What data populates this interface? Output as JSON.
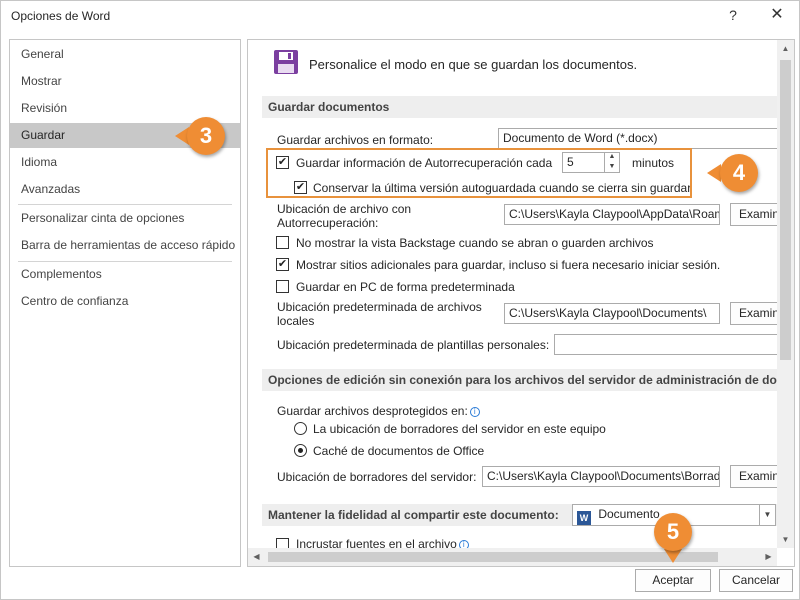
{
  "window": {
    "title": "Opciones de Word",
    "help_label": "?",
    "close_label": "✕"
  },
  "sidebar": {
    "items": [
      {
        "label": "General"
      },
      {
        "label": "Mostrar"
      },
      {
        "label": "Revisión"
      },
      {
        "label": "Guardar",
        "active": true
      },
      {
        "label": "Idioma"
      },
      {
        "label": "Avanzadas"
      },
      {
        "label": "Personalizar cinta de opciones"
      },
      {
        "label": "Barra de herramientas de acceso rápido"
      },
      {
        "label": "Complementos"
      },
      {
        "label": "Centro de confianza"
      }
    ]
  },
  "main": {
    "header": "Personalice el modo en que se guardan los documentos.",
    "save_section": {
      "title": "Guardar documentos",
      "format_label": "Guardar archivos en formato:",
      "format_value": "Documento de Word (*.docx)",
      "autorecover_label": "Guardar información de Autorrecuperación cada",
      "autorecover_minutes": "5",
      "minutes_label": "minutos",
      "keep_last_label": "Conservar la última versión autoguardada cuando se cierra sin guardar",
      "autorecover_location_label": "Ubicación de archivo con Autorrecuperación:",
      "autorecover_location_value": "C:\\Users\\Kayla Claypool\\AppData\\Roaming",
      "browse_label": "Examinar...",
      "no_backstage_label": "No mostrar la vista Backstage cuando se abran o guarden archivos",
      "show_places_label": "Mostrar sitios adicionales para guardar, incluso si fuera necesario iniciar sesión.",
      "save_pc_label": "Guardar en PC de forma predeterminada",
      "default_local_label": "Ubicación predeterminada de archivos locales",
      "default_local_value": "C:\\Users\\Kayla Claypool\\Documents\\",
      "templates_label": "Ubicación predeterminada de plantillas personales:",
      "templates_value": ""
    },
    "offline_section": {
      "title": "Opciones de edición sin conexión para los archivos del servidor de administración de documentos",
      "checkout_label": "Guardar archivos desprotegidos en:",
      "radio_server_label": "La ubicación de borradores del servidor en este equipo",
      "radio_cache_label": "Caché de documentos de Office",
      "drafts_location_label": "Ubicación de borradores del servidor:",
      "drafts_location_value": "C:\\Users\\Kayla Claypool\\Documents\\Borradores de SharePoint\\",
      "browse_label": "Examinar..."
    },
    "fidelity_section": {
      "title": "Mantener la fidelidad al compartir este documento:",
      "document_value": "Documento",
      "embed_fonts_label": "Incrustar fuentes en el archivo"
    }
  },
  "footer": {
    "ok_label": "Aceptar",
    "cancel_label": "Cancelar"
  },
  "callouts": {
    "three": "3",
    "four": "4",
    "five": "5"
  },
  "colors": {
    "accent": "#ef8d34",
    "active_nav": "#c8c8c8",
    "save_icon": "#7b3fa0"
  }
}
